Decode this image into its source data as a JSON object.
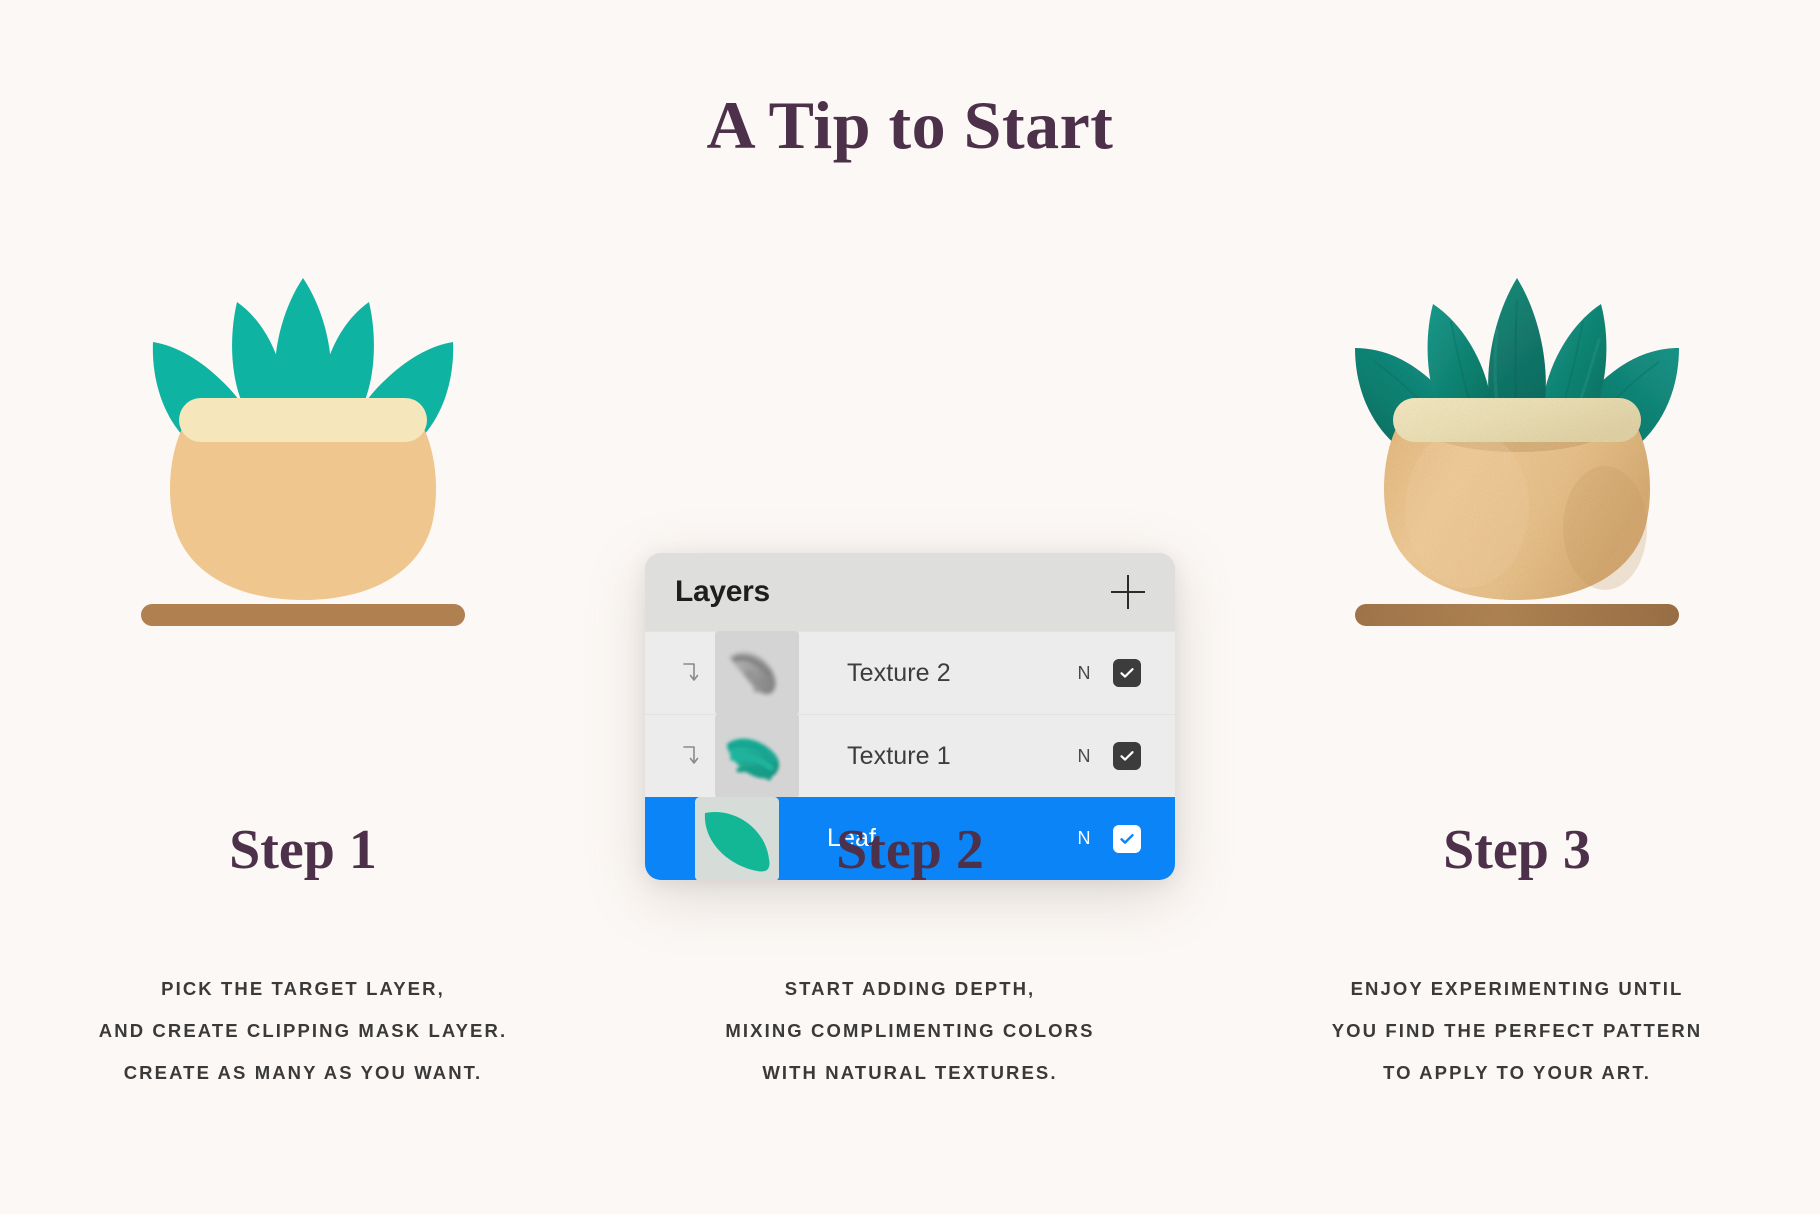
{
  "page": {
    "title": "A Tip to Start",
    "background_color": "#FCF8F5",
    "title_color": "#4D3049",
    "body_text_color": "#3A3A3A"
  },
  "palette": {
    "teal_flat": "#0FB3A2",
    "teal_textured": "#158174",
    "pot_tan": "#EFC68D",
    "pot_rim_cream": "#F5E6BB",
    "shelf_brown": "#B08050",
    "selection_blue": "#0A84F7",
    "panel_header_grey": "#DEDEDD",
    "panel_row_grey": "#ECECEC",
    "checkbox_dark": "#3C3C3C"
  },
  "layers_panel": {
    "title": "Layers",
    "add_layer_icon": "plus-icon",
    "rows": [
      {
        "name": "Texture 2",
        "blend_mode": "N",
        "visible": true,
        "clipped": true,
        "thumbnail": "grey-brush-stroke",
        "selected": false
      },
      {
        "name": "Texture 1",
        "blend_mode": "N",
        "visible": true,
        "clipped": true,
        "thumbnail": "teal-brush-stroke",
        "selected": false
      },
      {
        "name": "Leaf",
        "blend_mode": "N",
        "visible": true,
        "clipped": false,
        "thumbnail": "teal-leaf-shape",
        "selected": true
      }
    ]
  },
  "steps": [
    {
      "heading": "Step 1",
      "art": "flat-potted-plant",
      "lines": [
        "PICK THE TARGET LAYER,",
        "AND CREATE CLIPPING MASK LAYER.",
        "CREATE AS MANY AS YOU WANT."
      ]
    },
    {
      "heading": "Step 2",
      "art": "layers-panel",
      "lines": [
        "START ADDING DEPTH,",
        "MIXING COMPLIMENTING COLORS",
        "WITH NATURAL TEXTURES."
      ]
    },
    {
      "heading": "Step 3",
      "art": "textured-potted-plant",
      "lines": [
        "ENJOY EXPERIMENTING UNTIL",
        "YOU FIND THE PERFECT PATTERN",
        "TO APPLY TO YOUR ART."
      ]
    }
  ]
}
